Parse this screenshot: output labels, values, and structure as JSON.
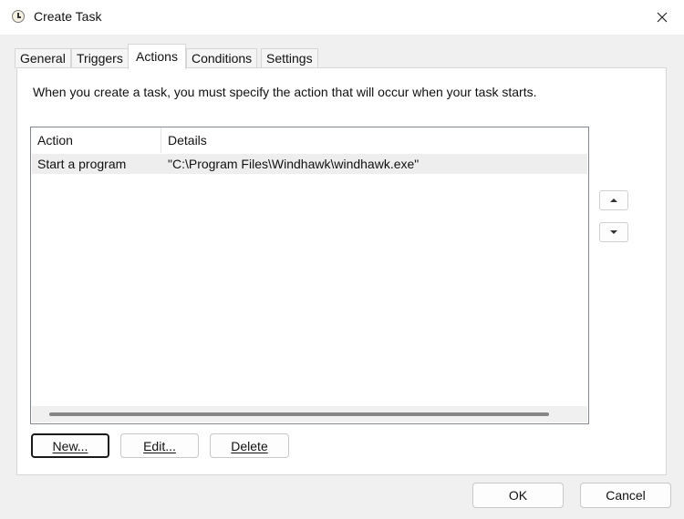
{
  "window": {
    "title": "Create Task",
    "app_icon": "clock-icon",
    "close_icon": "close-icon"
  },
  "tabs": [
    {
      "label": "General",
      "active": false
    },
    {
      "label": "Triggers",
      "active": false
    },
    {
      "label": "Actions",
      "active": true
    },
    {
      "label": "Conditions",
      "active": false
    },
    {
      "label": "Settings",
      "active": false
    }
  ],
  "actions": {
    "instruction": "When you create a task, you must specify the action that will occur when your task starts.",
    "columns": [
      "Action",
      "Details"
    ],
    "rows": [
      {
        "action": "Start a program",
        "details": "\"C:\\Program Files\\Windhawk\\windhawk.exe\""
      }
    ],
    "move_up_icon": "triangle-up-icon",
    "move_down_icon": "triangle-down-icon",
    "buttons": {
      "new": "New...",
      "edit": "Edit...",
      "delete": "Delete"
    }
  },
  "footer": {
    "ok": "OK",
    "cancel": "Cancel"
  }
}
